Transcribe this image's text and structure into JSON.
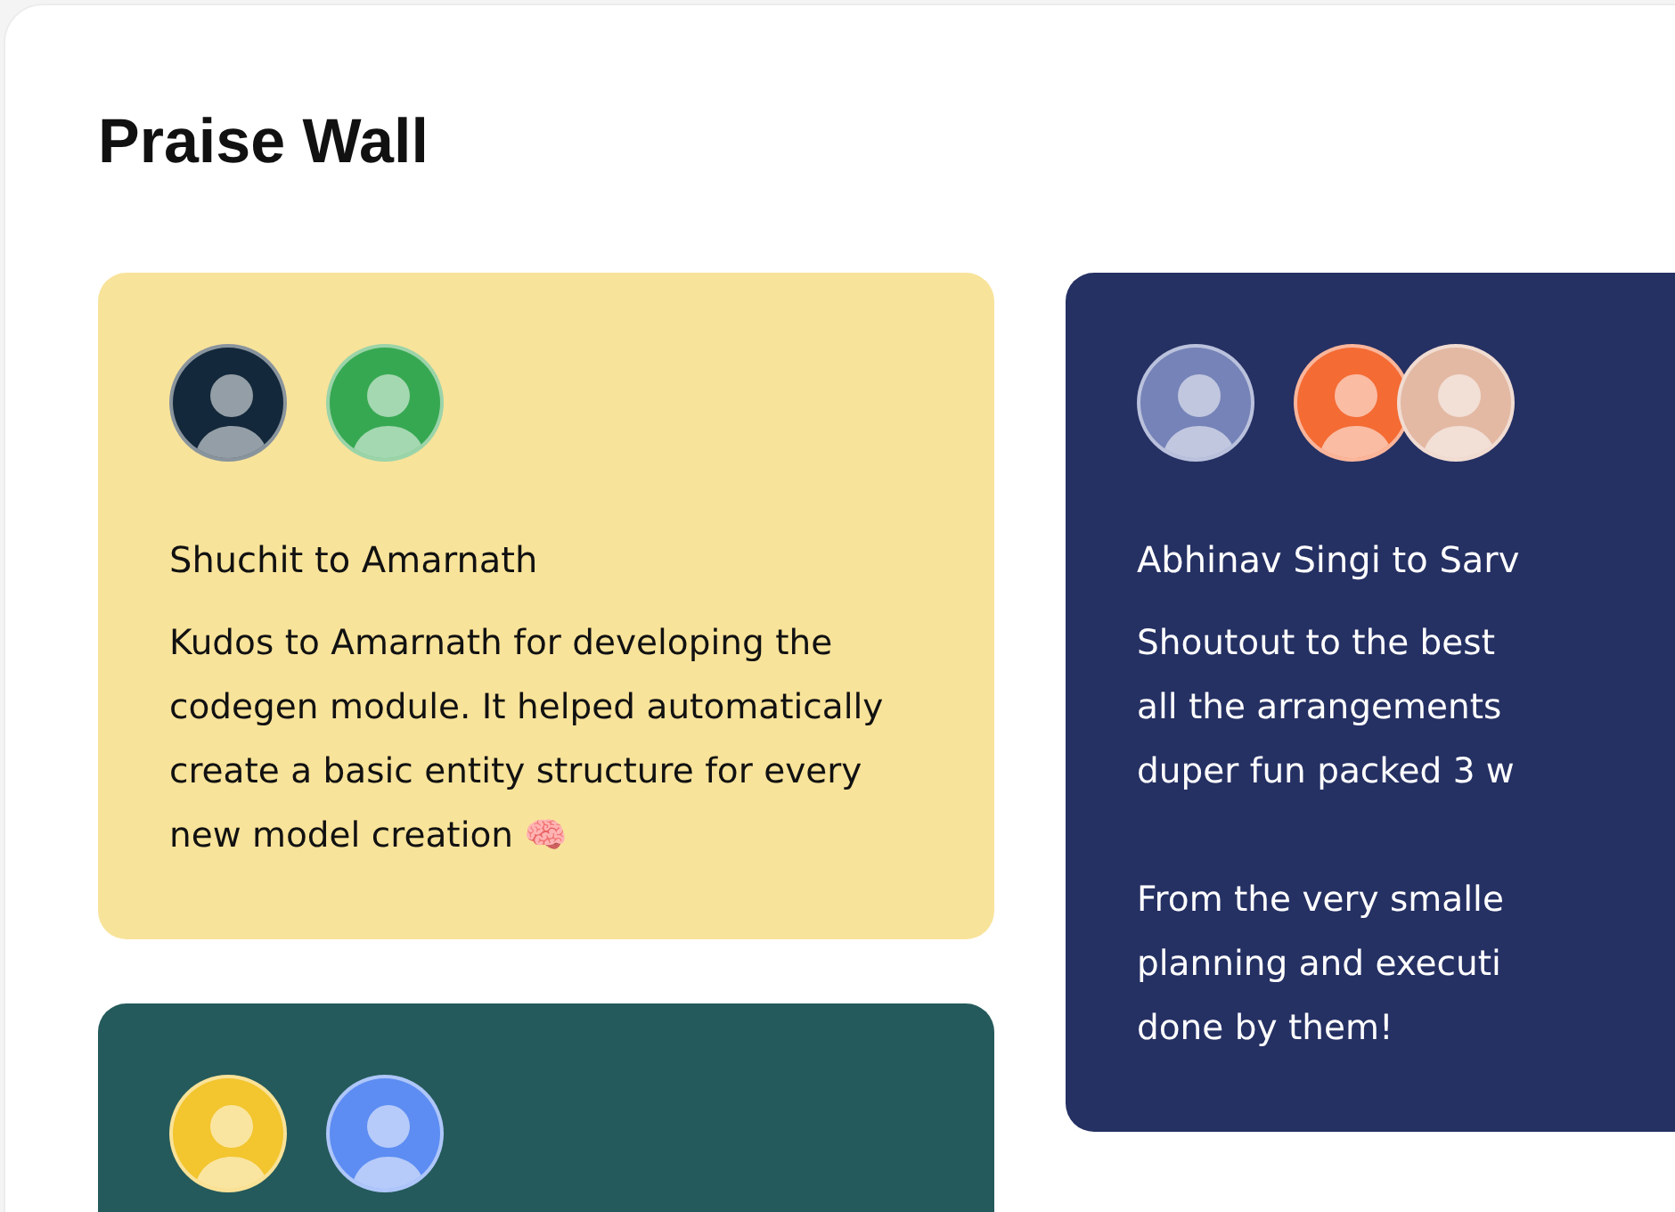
{
  "title": "Praise Wall",
  "cards": [
    {
      "color": "#f8e39a",
      "avatars": [
        {
          "color": "#13283a"
        },
        {
          "color": "#37a852"
        }
      ],
      "heading": "Shuchit to Amarnath",
      "paragraphs": [
        [
          "Kudos to Amarnath for developing the codegen module. It helped automatically create a basic entity structure for every new model creation 🧠"
        ]
      ]
    },
    {
      "color": "#253063",
      "avatars": [
        {
          "color": "#7583b8"
        },
        {
          "color": "#f46b34"
        },
        {
          "color": "#e3b9a4"
        }
      ],
      "heading": "Abhinav Singi to Sarv",
      "paragraphs": [
        [
          "Shoutout to the best",
          "all the arrangements",
          "duper fun packed 3 w"
        ],
        [
          "From the very smalle",
          "planning and executi",
          "done by them!"
        ]
      ]
    },
    {
      "color": "#245a5b",
      "avatars": [
        {
          "color": "#f3c52e"
        },
        {
          "color": "#5d8df3"
        }
      ]
    }
  ]
}
